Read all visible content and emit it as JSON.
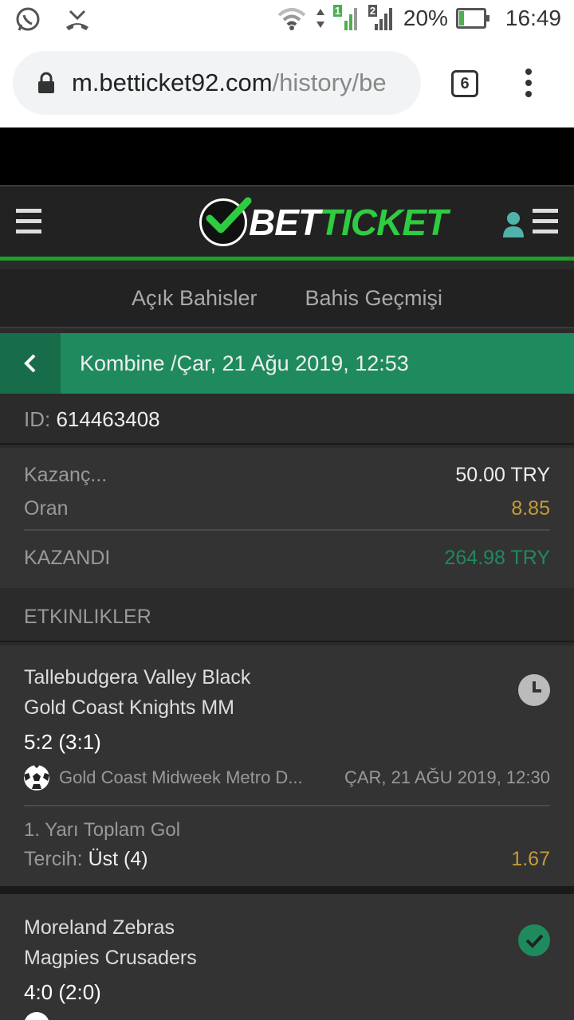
{
  "statusbar": {
    "battery": "20%",
    "time": "16:49",
    "sim1": "1",
    "sim2": "2",
    "battery_level": 0.2
  },
  "browser": {
    "url_host": "m.betticket92.com",
    "url_path": "/history/be",
    "tab_count": "6"
  },
  "header": {
    "logo_white": "BET",
    "logo_green": "TICKET"
  },
  "tabs": [
    {
      "label": "Açık Bahisler"
    },
    {
      "label": "Bahis Geçmişi"
    }
  ],
  "title": "Kombine /Çar, 21 Ağu 2019, 12:53",
  "ticket": {
    "id_label": "ID:",
    "id_value": "614463408"
  },
  "summary": {
    "stake_label": "Kazanç...",
    "stake_value": "50.00 TRY",
    "odds_label": "Oran",
    "odds_value": "8.85",
    "result_label": "KAZANDI",
    "result_value": "264.98 TRY"
  },
  "events_header": "ETKINLIKLER",
  "events": [
    {
      "home": "Tallebudgera Valley Black",
      "away": "Gold Coast Knights MM",
      "score": "5:2 (3:1)",
      "status_icon": "clock-icon",
      "league": "Gold Coast Midweek Metro D...",
      "date": "ÇAR, 21 AĞU 2019, 12:30",
      "market": "1. Yarı Toplam Gol",
      "pick_label": "Tercih:",
      "pick_value": "Üst (4)",
      "odds": "1.67"
    },
    {
      "home": "Moreland Zebras",
      "away": "Magpies Crusaders",
      "score": "4:0 (2:0)",
      "status_icon": "check-icon"
    }
  ],
  "colors": {
    "accent_green": "#1f8a5e",
    "odds_gold": "#c49a3a",
    "win_green": "#1f8a5e"
  }
}
